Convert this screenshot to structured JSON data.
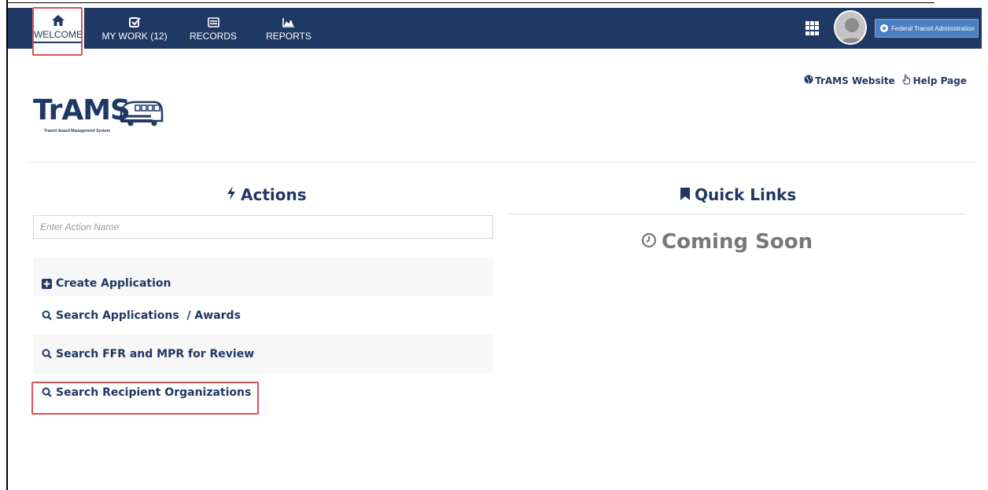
{
  "nav": {
    "items": [
      {
        "label": "WELCOME",
        "icon": "home-icon"
      },
      {
        "label": "MY WORK (12)",
        "icon": "checkbox-icon"
      },
      {
        "label": "RECORDS",
        "icon": "list-icon"
      },
      {
        "label": "REPORTS",
        "icon": "chart-area-icon"
      }
    ],
    "active": "WELCOME",
    "org_label": "Federal Transit Administration"
  },
  "header": {
    "website_link": "TrAMS Website",
    "help_link": "Help Page",
    "logo_text": "TrAMS",
    "logo_subtext": "Transit Award Management System"
  },
  "actions": {
    "title": "Actions",
    "search_placeholder": "Enter Action Name",
    "items": [
      {
        "label": "Create Application",
        "icon": "plus-square-icon"
      },
      {
        "label": "Search Applications  / Awards",
        "icon": "search-icon"
      },
      {
        "label": "Search FFR and MPR for Review",
        "icon": "search-icon"
      },
      {
        "label": "Search Recipient Organizations",
        "icon": "search-icon"
      }
    ]
  },
  "quick_links": {
    "title": "Quick Links",
    "status": "Coming Soon"
  },
  "colors": {
    "nav_bg": "#1f3864",
    "text_primary": "#1f3864",
    "badge_bg": "#4a7fc1",
    "highlight": "#d9534f",
    "muted": "#777777"
  }
}
